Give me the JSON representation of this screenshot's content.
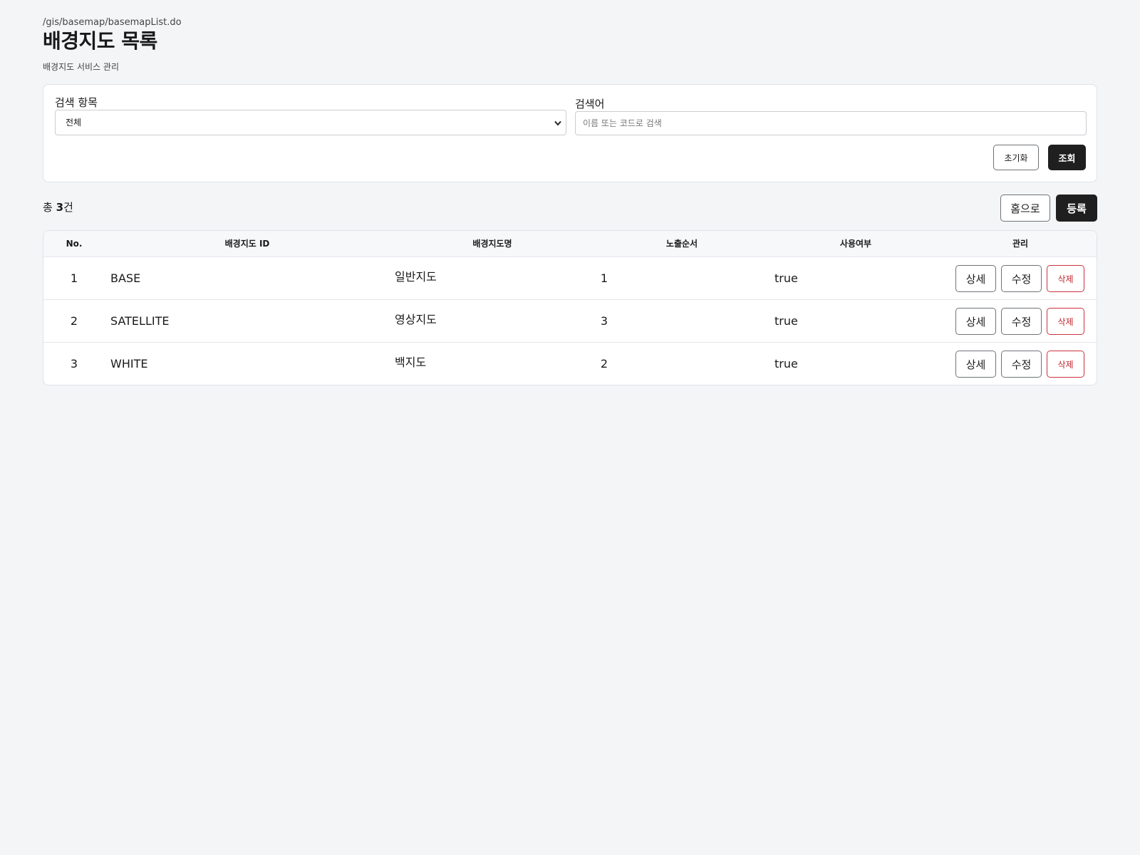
{
  "header": {
    "path": "/gis/basemap/basemapList.do",
    "title": "배경지도 목록",
    "subtitle": "배경지도 서비스 관리"
  },
  "search": {
    "category_label": "검색 항목",
    "category_selected": "전체",
    "keyword_label": "검색어",
    "keyword_placeholder": "이름 또는 코드로 검색",
    "keyword_value": "",
    "reset_label": "초기화",
    "query_label": "조회"
  },
  "summary": {
    "prefix": "총 ",
    "count": "3",
    "suffix": "건",
    "home_label": "홈으로",
    "register_label": "등록"
  },
  "table": {
    "columns": [
      "No.",
      "배경지도 ID",
      "배경지도명",
      "노출순서",
      "사용여부",
      "관리"
    ],
    "rows": [
      {
        "no": "1",
        "id": "BASE",
        "name": "일반지도",
        "order": "1",
        "use": "true"
      },
      {
        "no": "2",
        "id": "SATELLITE",
        "name": "영상지도",
        "order": "3",
        "use": "true"
      },
      {
        "no": "3",
        "id": "WHITE",
        "name": "백지도",
        "order": "2",
        "use": "true"
      }
    ],
    "actions": {
      "detail": "상세",
      "edit": "수정",
      "delete": "삭제"
    }
  },
  "colors": {
    "background": "#f4f5f7",
    "primary_dark": "#1f1f1f",
    "danger": "#c0262f",
    "border": "#dfe2e6"
  },
  "icons": {
    "select_arrow": "chevron-down-icon"
  }
}
